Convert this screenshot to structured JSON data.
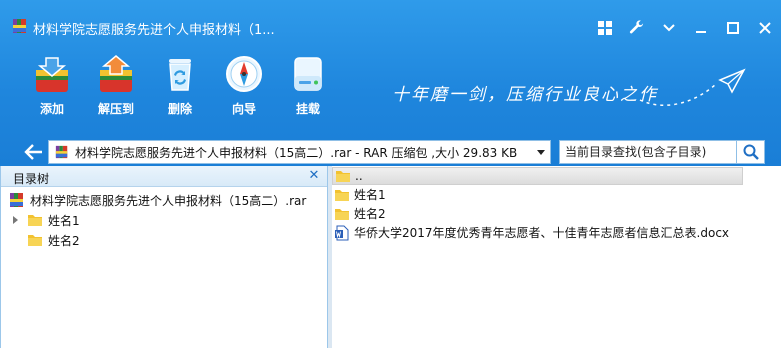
{
  "window": {
    "title": "材料学院志愿服务先进个人申报材料（1...",
    "controls": [
      "grid-icon",
      "wrench-icon",
      "chevron-down-icon",
      "minimize-icon",
      "maximize-icon",
      "close-icon"
    ]
  },
  "toolbar": {
    "items": [
      {
        "label": "添加",
        "icon": "add-archive-icon"
      },
      {
        "label": "解压到",
        "icon": "extract-icon"
      },
      {
        "label": "删除",
        "icon": "recycle-bin-icon"
      },
      {
        "label": "向导",
        "icon": "compass-icon"
      },
      {
        "label": "挂载",
        "icon": "drive-icon"
      }
    ],
    "slogan": "十年磨一剑，压缩行业良心之作"
  },
  "address": {
    "path": "材料学院志愿服务先进个人申报材料（15高二）.rar - RAR 压缩包 ,大小 29.83 KB",
    "search_placeholder": "当前目录查找(包含子目录)"
  },
  "tree": {
    "title": "目录树",
    "root": "材料学院志愿服务先进个人申报材料（15高二）.rar",
    "children": [
      "姓名1",
      "姓名2"
    ]
  },
  "files": {
    "up": "..",
    "items": [
      {
        "name": "姓名1",
        "type": "folder"
      },
      {
        "name": "姓名2",
        "type": "folder"
      },
      {
        "name": "华侨大学2017年度优秀青年志愿者、十佳青年志愿者信息汇总表.docx",
        "type": "docx"
      }
    ]
  },
  "colors": {
    "header_blue": "#1f86dd",
    "folder_yellow": "#f2c230",
    "panel_border": "#9cc7ea"
  }
}
